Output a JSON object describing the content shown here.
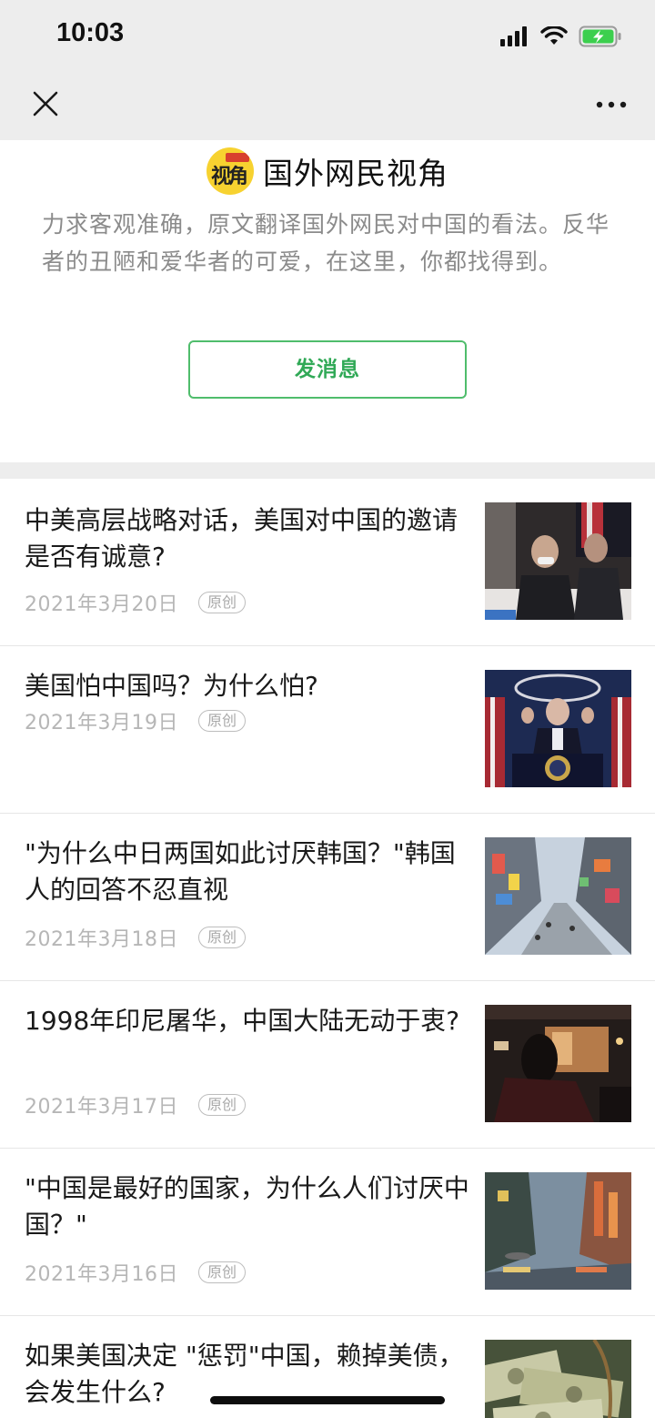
{
  "status_bar": {
    "time": "10:03"
  },
  "account": {
    "logo_text": "视角",
    "name": "国外网民视角",
    "description": "力求客观准确，原文翻译国外网民对中国的看法。反华者的丑陋和爱华者的可爱，在这里，你都找得到。",
    "message_button": "发消息"
  },
  "articles": [
    {
      "title": "中美高层战略对话，美国对中国的邀请是否有诚意?",
      "date": "2021年3月20日",
      "badge": "原创"
    },
    {
      "title": "美国怕中国吗？为什么怕?",
      "date": "2021年3月19日",
      "badge": "原创"
    },
    {
      "title": "\"为什么中日两国如此讨厌韩国？\"韩国人的回答不忍直视",
      "date": "2021年3月18日",
      "badge": "原创"
    },
    {
      "title": "1998年印尼屠华，中国大陆无动于衷?",
      "date": "2021年3月17日",
      "badge": "原创"
    },
    {
      "title": "\"中国是最好的国家，为什么人们讨厌中国？\"",
      "date": "2021年3月16日",
      "badge": "原创"
    },
    {
      "title": "如果美国决定 \"惩罚\"中国，赖掉美债，会发生什么?",
      "date": "",
      "badge": ""
    }
  ],
  "colors": {
    "accent_green": "#31a957",
    "bar_gray": "#ededed",
    "battery_green": "#3ccf4e"
  }
}
